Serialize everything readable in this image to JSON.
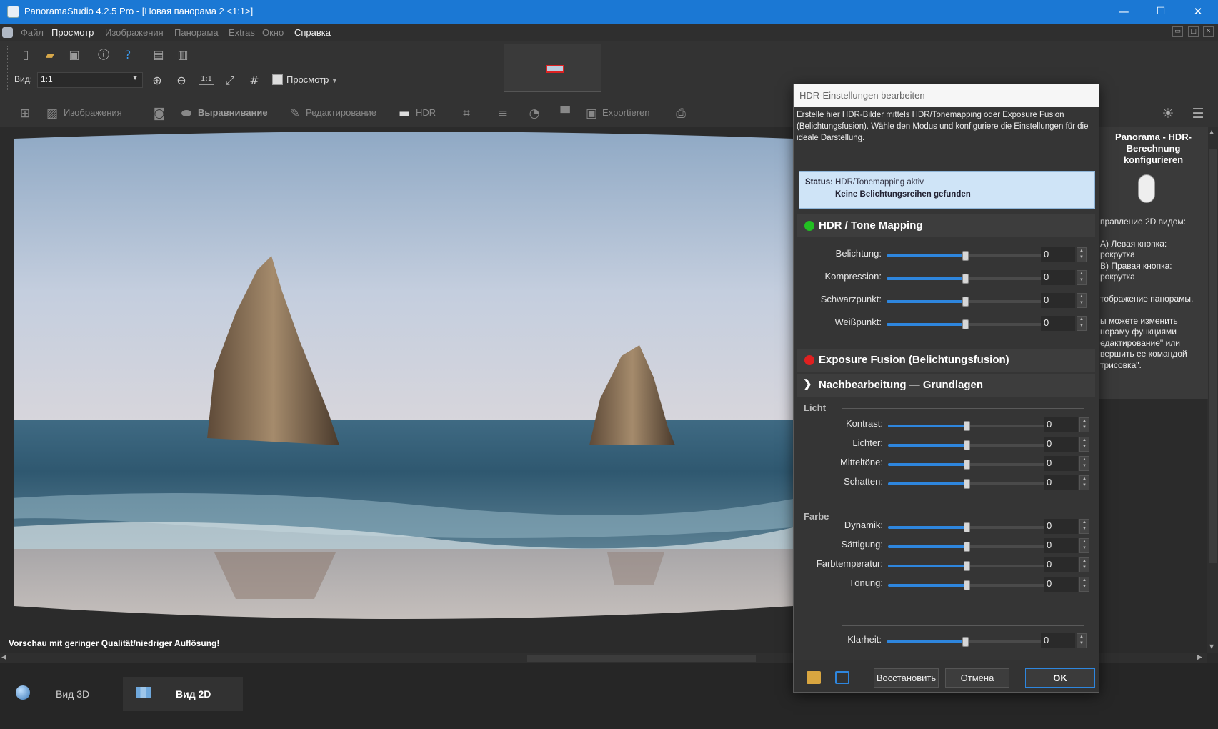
{
  "window": {
    "title": "PanoramaStudio 4.2.5 Pro - [Новая панорама 2 <1:1>]",
    "minimize": "—",
    "maximize": "☐",
    "close": "✕"
  },
  "menu": {
    "items": [
      "Файл",
      "Просмотр",
      "Изображения",
      "Панорама",
      "Extras",
      "Окно",
      "Справка"
    ],
    "active": [
      "Просмотр",
      "Справка"
    ]
  },
  "toolbar": {
    "view_label": "Вид:",
    "view_value": "1:1",
    "zoom_1to1": "1:1",
    "preview_label": "Просмотр"
  },
  "workflow": {
    "images": "Изображения",
    "alignment": "Выравнивание",
    "editing": "Редактирование",
    "hdr": "HDR",
    "export": "Exportieren"
  },
  "view": {
    "low_quality_notice": "Vorschau mit geringer Qualität/niedriger Auflösung!"
  },
  "bottom_tabs": {
    "view3d": "Вид 3D",
    "view2d": "Вид 2D",
    "active": "Вид 2D"
  },
  "help_panel": {
    "title": "Panorama - HDR-Berechnung konfigurieren",
    "lines": [
      "правление 2D видом:",
      "А) Левая кнопка:",
      "рокрутка",
      "В) Правая кнопка:",
      "рокрутка",
      "тображение панорамы.",
      "ы можете изменить",
      "нораму функциями",
      "едактирование\" или",
      "вершить ее командой",
      "трисовка\"."
    ]
  },
  "dialog": {
    "title": "HDR-Einstellungen bearbeiten",
    "description": "Erstelle hier HDR-Bilder mittels HDR/Tonemapping oder Exposure Fusion (Belichtungsfusion). Wähle den Modus und konfiguriere die Einstellungen für die ideale Darstellung.",
    "status_label": "Status:",
    "status_mode": "HDR/Tonemapping aktiv",
    "status_message": "Keine Belichtungsreihen gefunden",
    "sections": {
      "hdr": "HDR / Tone Mapping",
      "fusion": "Exposure Fusion (Belichtungsfusion)",
      "post": "Nachbearbeitung — Grundlagen"
    },
    "status_colors": {
      "hdr_active": "#22c022",
      "fusion_inactive": "#e02020"
    },
    "hdr_sliders": [
      {
        "label": "Belichtung:",
        "value": "0",
        "level": 0.5
      },
      {
        "label": "Kompression:",
        "value": "0",
        "level": 0.5
      },
      {
        "label": "Schwarzpunkt:",
        "value": "0",
        "level": 0.5
      },
      {
        "label": "Weißpunkt:",
        "value": "0",
        "level": 0.5
      }
    ],
    "group_light": "Licht",
    "light_sliders": [
      {
        "label": "Kontrast:",
        "value": "0",
        "level": 0.5
      },
      {
        "label": "Lichter:",
        "value": "0",
        "level": 0.5
      },
      {
        "label": "Mitteltöne:",
        "value": "0",
        "level": 0.5
      },
      {
        "label": "Schatten:",
        "value": "0",
        "level": 0.5
      }
    ],
    "group_color": "Farbe",
    "color_sliders": [
      {
        "label": "Dynamik:",
        "value": "0",
        "level": 0.5
      },
      {
        "label": "Sättigung:",
        "value": "0",
        "level": 0.5
      },
      {
        "label": "Farbtemperatur:",
        "value": "0",
        "level": 0.5
      },
      {
        "label": "Tönung:",
        "value": "0",
        "level": 0.5
      }
    ],
    "clarity": {
      "label": "Klarheit:",
      "value": "0",
      "level": 0.5
    },
    "buttons": {
      "restore": "Восстановить",
      "cancel": "Отмена",
      "ok": "OK"
    }
  }
}
